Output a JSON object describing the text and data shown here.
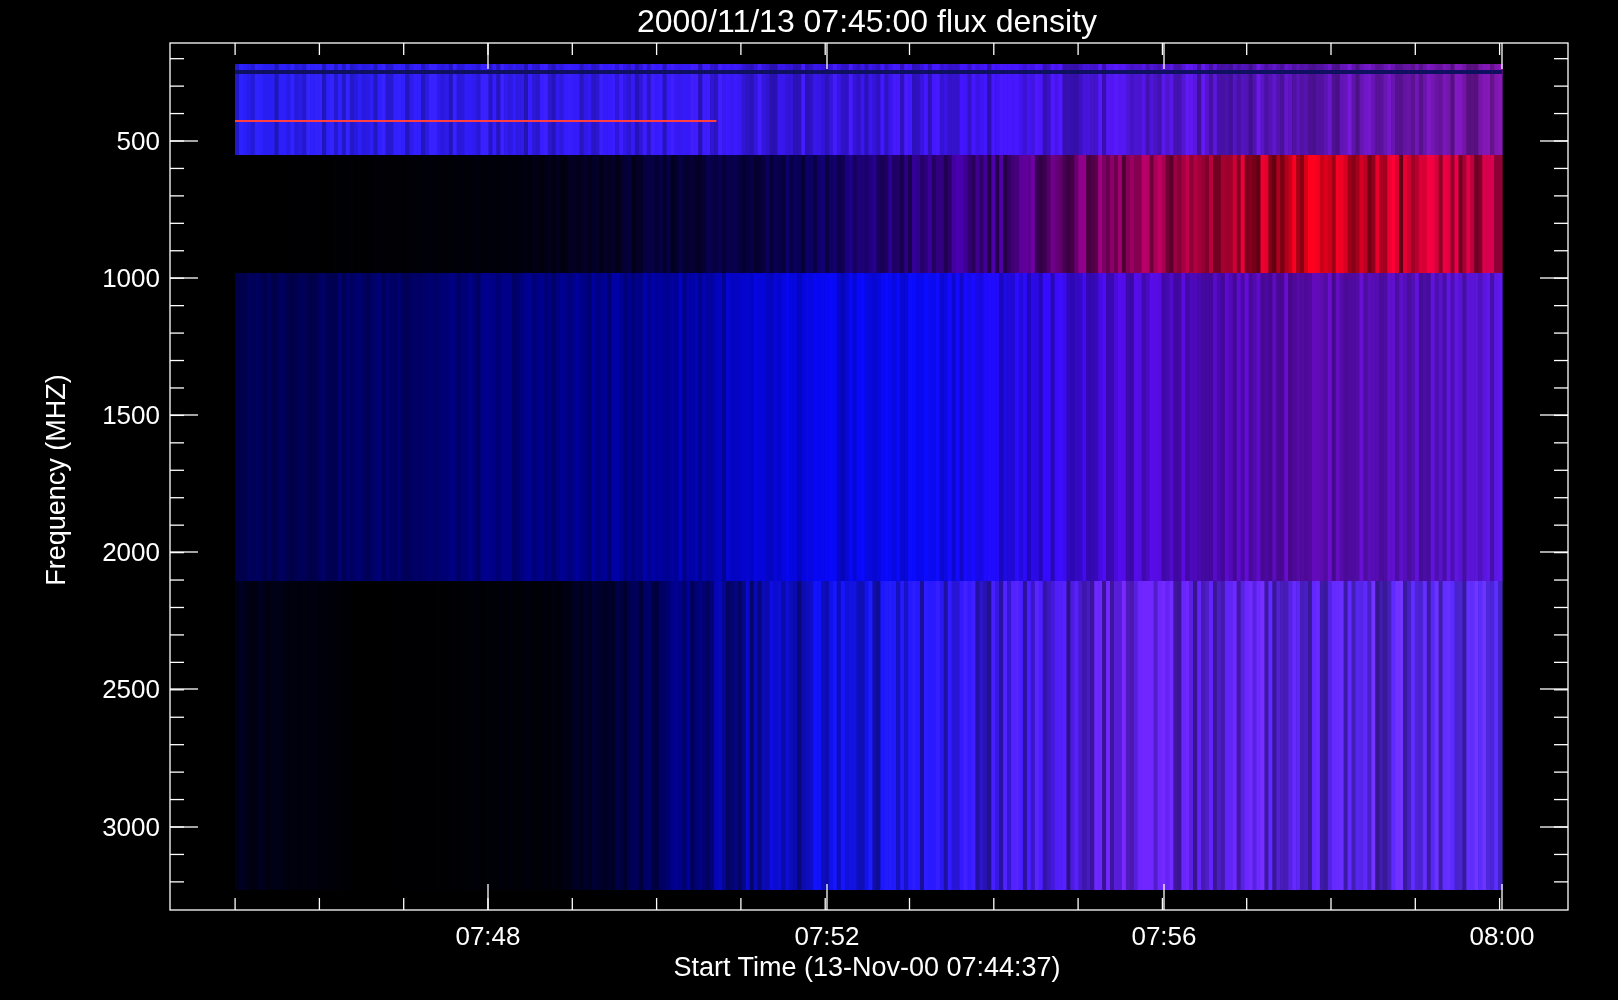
{
  "plot": {
    "title": "2000/11/13 07:45:00 flux density",
    "xlabel": "Start Time (13-Nov-00 07:44:37)",
    "ylabel": "Frequency (MHZ)",
    "xtick_labels": [
      "07:48",
      "07:52",
      "07:56",
      "08:00"
    ],
    "ytick_labels": [
      "500",
      "1000",
      "1500",
      "2000",
      "2500",
      "3000"
    ]
  }
}
